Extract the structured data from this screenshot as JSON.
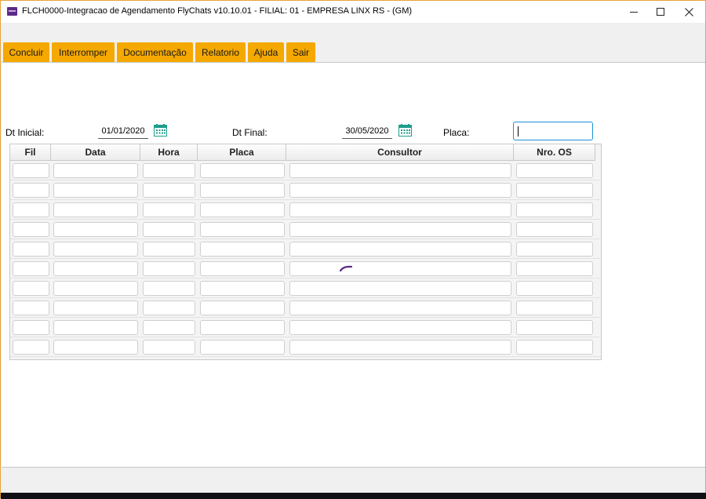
{
  "window": {
    "title": "FLCH0000-Integracao de Agendamento FlyChats v10.10.01   - FILIAL: 01 - EMPRESA LINX RS - (GM)"
  },
  "menu": [
    {
      "label": "Concluir"
    },
    {
      "label": "Interromper"
    },
    {
      "label": "Documentação"
    },
    {
      "label": "Relatorio"
    },
    {
      "label": "Ajuda"
    },
    {
      "label": "Sair"
    }
  ],
  "filters": {
    "dt_inicial_label": "Dt Inicial:",
    "dt_inicial_value": "01/01/2020",
    "dt_final_label": "Dt Final:",
    "dt_final_value": "30/05/2020",
    "placa_label": "Placa:",
    "placa_value": ""
  },
  "grid": {
    "columns": [
      "Fil",
      "Data",
      "Hora",
      "Placa",
      "Consultor",
      "Nro. OS"
    ],
    "rows": [
      [
        "",
        "",
        "",
        "",
        "",
        ""
      ],
      [
        "",
        "",
        "",
        "",
        "",
        ""
      ],
      [
        "",
        "",
        "",
        "",
        "",
        ""
      ],
      [
        "",
        "",
        "",
        "",
        "",
        ""
      ],
      [
        "",
        "",
        "",
        "",
        "",
        ""
      ],
      [
        "",
        "",
        "",
        "",
        "",
        ""
      ],
      [
        "",
        "",
        "",
        "",
        "",
        ""
      ],
      [
        "",
        "",
        "",
        "",
        "",
        ""
      ],
      [
        "",
        "",
        "",
        "",
        "",
        ""
      ],
      [
        "",
        "",
        "",
        "",
        "",
        ""
      ]
    ]
  },
  "icons": {
    "app": "app-icon",
    "calendar": "calendar-icon",
    "loading": "loading-spinner-icon"
  },
  "colors": {
    "menu_background": "#f5a800",
    "window_border": "#e8a33d",
    "focus_border": "#1e8fd8",
    "spinner": "#5b2a86",
    "calendar": "#1f9d8a"
  }
}
